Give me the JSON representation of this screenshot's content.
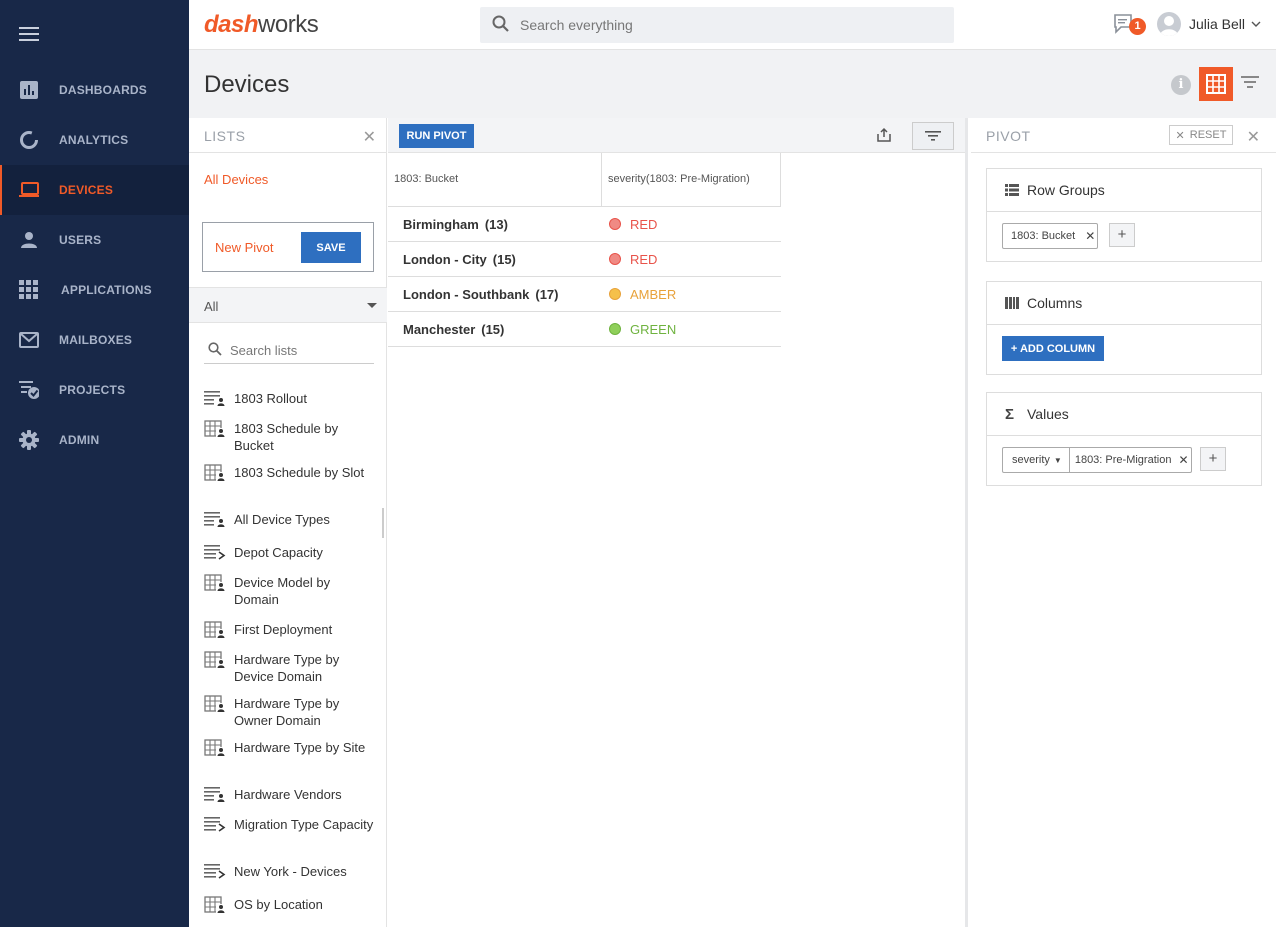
{
  "app": {
    "logo_part1": "dash",
    "logo_part2": "works",
    "search_placeholder": "Search everything",
    "notification_count": "1",
    "user_name": "Julia Bell",
    "brand_color": "#f05a28"
  },
  "sidebar": {
    "items": [
      {
        "label": "DASHBOARDS",
        "icon": "chart-icon"
      },
      {
        "label": "ANALYTICS",
        "icon": "donut-icon"
      },
      {
        "label": "DEVICES",
        "icon": "laptop-icon",
        "active": true
      },
      {
        "label": "USERS",
        "icon": "person-icon"
      },
      {
        "label": "APPLICATIONS",
        "icon": "apps-grid-icon"
      },
      {
        "label": "MAILBOXES",
        "icon": "mail-icon"
      },
      {
        "label": "PROJECTS",
        "icon": "checklist-icon"
      },
      {
        "label": "ADMIN",
        "icon": "gear-icon"
      }
    ]
  },
  "page": {
    "title": "Devices"
  },
  "lists": {
    "title": "LISTS",
    "all_devices": "All Devices",
    "new_pivot": "New Pivot",
    "save_label": "SAVE",
    "filter_value": "All",
    "search_placeholder": "Search lists",
    "items": [
      {
        "label": "1803 Rollout",
        "icon": "list-user-icon"
      },
      {
        "label": "1803 Schedule by Bucket",
        "icon": "pivot-user-icon"
      },
      {
        "label": "1803 Schedule by Slot",
        "icon": "pivot-user-icon"
      },
      {
        "label": "All Device Types",
        "icon": "list-user-icon"
      },
      {
        "label": "Depot Capacity",
        "icon": "list-arrow-icon"
      },
      {
        "label": "Device Model by Domain",
        "icon": "pivot-user-icon"
      },
      {
        "label": "First Deployment",
        "icon": "pivot-user-icon"
      },
      {
        "label": "Hardware Type by Device Domain",
        "icon": "pivot-user-icon"
      },
      {
        "label": "Hardware Type by Owner Domain",
        "icon": "pivot-user-icon"
      },
      {
        "label": "Hardware Type by Site",
        "icon": "pivot-user-icon"
      },
      {
        "label": "Hardware Vendors",
        "icon": "list-user-icon"
      },
      {
        "label": "Migration Type Capacity",
        "icon": "list-arrow-icon"
      },
      {
        "label": "New York - Devices",
        "icon": "list-arrow-icon"
      },
      {
        "label": "OS by Location",
        "icon": "pivot-user-icon"
      }
    ]
  },
  "toolbar": {
    "run_pivot": "RUN PIVOT"
  },
  "grid": {
    "headers": [
      "1803: Bucket",
      "severity(1803: Pre-Migration)"
    ],
    "rows": [
      {
        "bucket": "Birmingham",
        "count": "(13)",
        "severity": "RED",
        "color": "#e8534a",
        "dot": "#f08a84"
      },
      {
        "bucket": "London - City",
        "count": "(15)",
        "severity": "RED",
        "color": "#e8534a",
        "dot": "#f08a84"
      },
      {
        "bucket": "London - Southbank",
        "count": "(17)",
        "severity": "AMBER",
        "color": "#e8a23a",
        "dot": "#f5c04a"
      },
      {
        "bucket": "Manchester",
        "count": "(15)",
        "severity": "GREEN",
        "color": "#6fb33f",
        "dot": "#8fcf5a"
      }
    ]
  },
  "pivot": {
    "title": "PIVOT",
    "reset_label": "RESET",
    "row_groups_title": "Row Groups",
    "row_group_chip": "1803: Bucket",
    "columns_title": "Columns",
    "add_column_label": "+ ADD COLUMN",
    "values_title": "Values",
    "value_agg": "severity",
    "value_field": "1803: Pre-Migration"
  }
}
